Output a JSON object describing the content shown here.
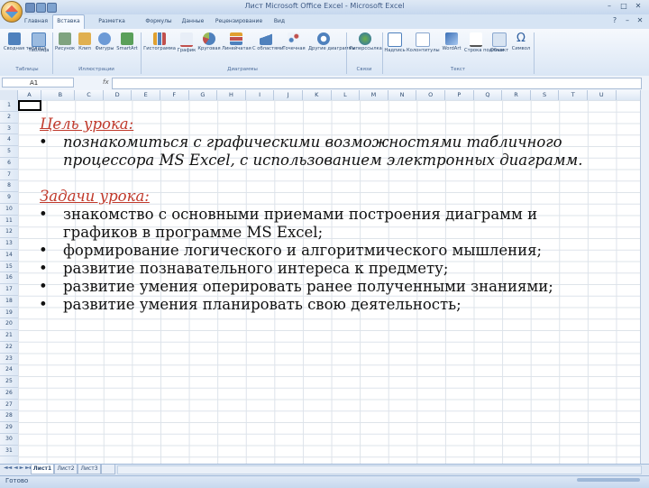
{
  "window": {
    "title": "Лист Microsoft Office Excel - Microsoft Excel"
  },
  "ribbon": {
    "tabs": [
      "Главная",
      "Вставка",
      "Разметка страницы",
      "Формулы",
      "Данные",
      "Рецензирование",
      "Вид"
    ],
    "buttons": {
      "pivot_table": "Сводная таблица",
      "table": "Таблица",
      "picture": "Рисунок",
      "clipart": "Клип",
      "shapes": "Фигуры",
      "smartart": "SmartArt",
      "histogram": "Гистограмма",
      "line_chart": "График",
      "pie_chart": "Круговая",
      "bar_chart": "Линейчатая",
      "area_chart": "С областями",
      "scatter_chart": "Точечная",
      "other_charts": "Другие диаграммы",
      "hyperlink": "Гиперссылка",
      "textbox": "Надпись",
      "header_footer": "Колонтитулы",
      "wordart": "WordArt",
      "signature_line": "Строка подписи",
      "object": "Объект",
      "symbol": "Символ"
    },
    "groups": {
      "tables": "Таблицы",
      "illustrations": "Иллюстрации",
      "charts": "Диаграммы",
      "links": "Связи",
      "text": "Текст"
    }
  },
  "formula_bar": {
    "name_box": "A1",
    "fx": "fx",
    "value": ""
  },
  "grid": {
    "columns": [
      "A",
      "B",
      "C",
      "D",
      "E",
      "F",
      "G",
      "H",
      "I",
      "J",
      "K",
      "L",
      "M",
      "N",
      "O",
      "P",
      "Q",
      "R",
      "S",
      "T",
      "U"
    ],
    "rows": [
      "1",
      "2",
      "3",
      "4",
      "5",
      "6",
      "7",
      "8",
      "9",
      "10",
      "11",
      "12",
      "13",
      "14",
      "15",
      "16",
      "17",
      "18",
      "19",
      "20",
      "21",
      "22",
      "23",
      "24",
      "25",
      "26",
      "27",
      "28",
      "29",
      "30",
      "31"
    ]
  },
  "content": {
    "goal_heading": "Цель урока:",
    "goal_items": [
      "познакомиться с графическими возможностями табличного процессора MS Excel, с использованием электронных диаграмм."
    ],
    "tasks_heading": "Задачи урока:",
    "task_items": [
      "знакомство с основными приемами построения диаграмм и графиков в программе MS Excel;",
      "формирование логического и алгоритмического мышления;",
      "развитие познавательного интереса к предмету;",
      "развитие умения оперировать ранее полученными знаниями;",
      "развитие умения планировать свою деятельность;"
    ],
    "bullet": "•"
  },
  "sheets": [
    "Лист1",
    "Лист2",
    "Лист3"
  ],
  "status": {
    "text": "Готово"
  },
  "colors": {
    "heading": "#c0392b",
    "ribbon_bg": "#dae6f5"
  }
}
